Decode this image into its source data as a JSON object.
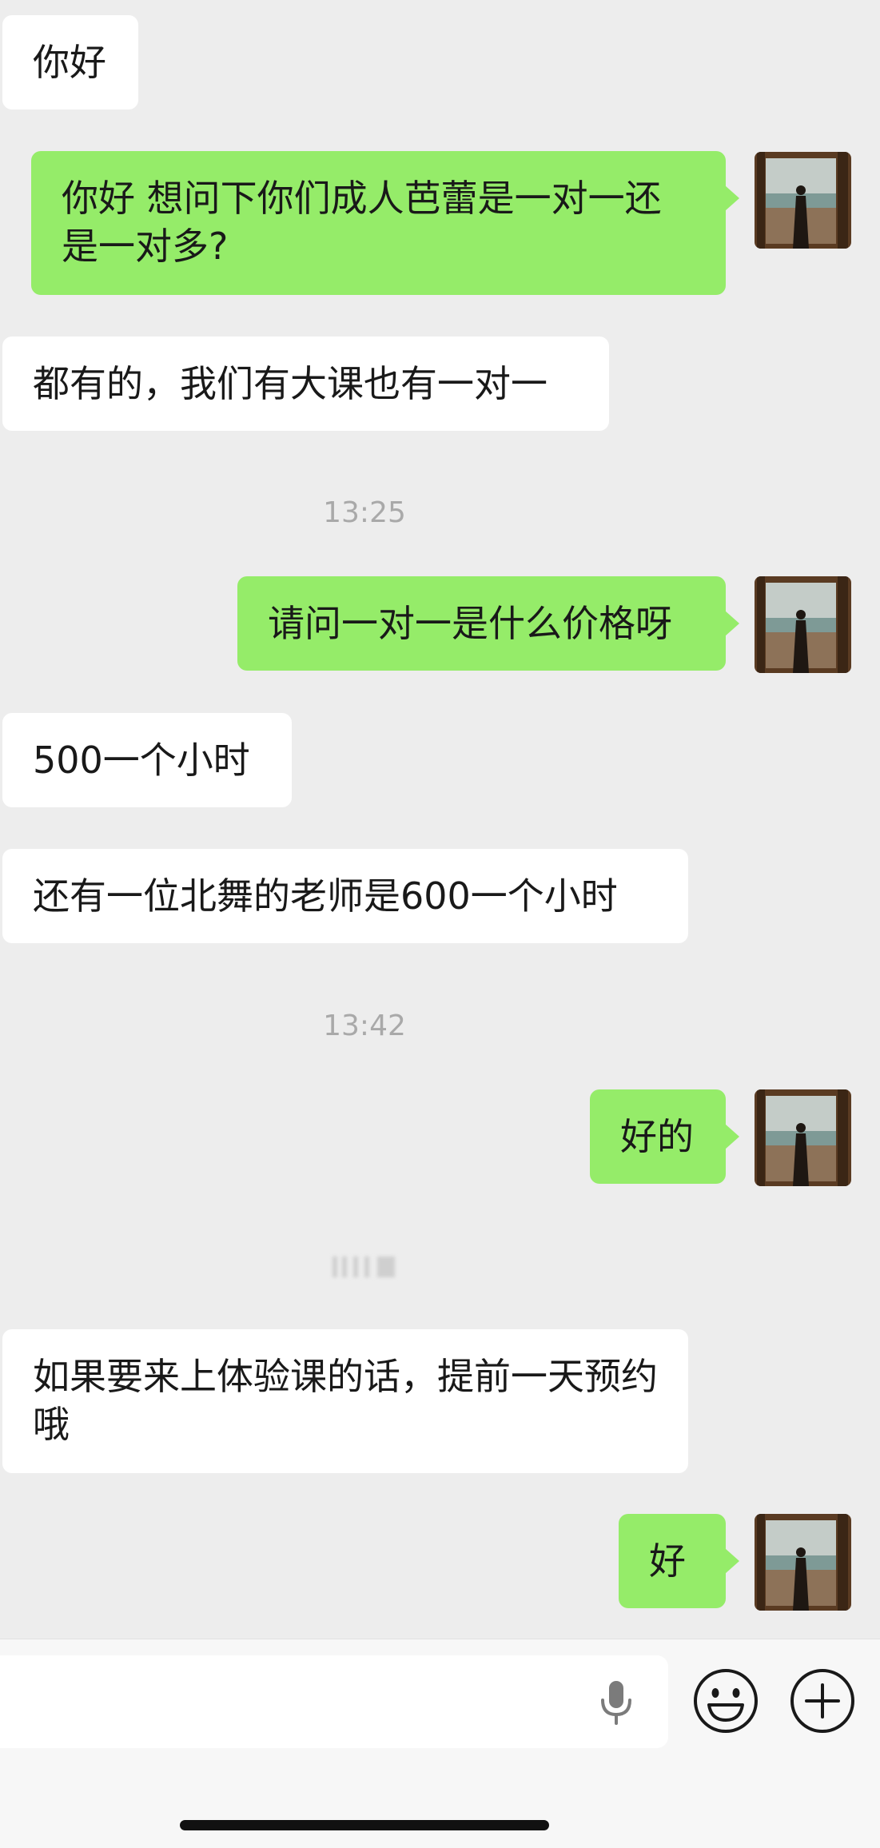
{
  "conversation": {
    "messages": [
      {
        "side": "in",
        "text": "你好"
      },
      {
        "side": "out",
        "text": "你好 想问下你们成人芭蕾是一对一还是一对多?"
      },
      {
        "side": "in",
        "text": "都有的，我们有大课也有一对一"
      },
      {
        "side": "in",
        "text": "500一个小时"
      },
      {
        "side": "in",
        "text": "还有一位北舞的老师是600一个小时"
      },
      {
        "side": "in",
        "text": "如果要来上体验课的话，提前一天预约哦"
      },
      {
        "side": "out",
        "text": "请问一对一是什么价格呀"
      },
      {
        "side": "out",
        "text": "好的"
      },
      {
        "side": "out",
        "text": "好"
      }
    ],
    "timestamps": [
      "13:25",
      "13:42"
    ]
  },
  "colors": {
    "background": "#ededed",
    "incoming_bubble": "#ffffff",
    "outgoing_bubble": "#95ec69",
    "timestamp_text": "#a9a9a9"
  },
  "icons": {
    "mic": "microphone-icon",
    "emoji": "smiley-icon",
    "plus": "plus-icon"
  }
}
